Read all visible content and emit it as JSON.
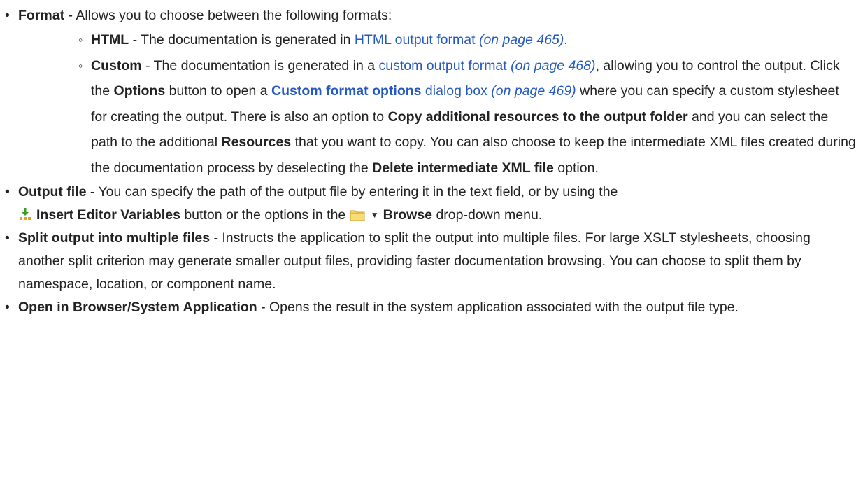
{
  "format": {
    "term": "Format",
    "desc": " - Allows you to choose between the following formats:",
    "html": {
      "term": "HTML",
      "t1": " - The documentation is generated in ",
      "link": "HTML output format",
      "ref": "(on page 465)",
      "t2": "."
    },
    "custom": {
      "term": "Custom",
      "t1": " - The documentation is generated in a ",
      "link": "custom output format",
      "ref1": "(on page 468)",
      "t2": ", allowing you to control the output. Click the ",
      "options": "Options",
      "t3": " button to open a ",
      "dialog_bold": "Custom format options",
      "dialog_rest": " dialog box",
      "ref2": "(on page 469)",
      "t4": " where you can specify a custom stylesheet for creating the output. There is also an option to ",
      "copy": "Copy additional resources to the output folder",
      "t5": " and you can select the path to the additional ",
      "resources": "Resources",
      "t6": " that you want to copy. You can also choose to keep the intermediate XML files created during the documentation process by deselecting the ",
      "delete": "Delete intermediate XML file",
      "t7": " option."
    }
  },
  "output_file": {
    "term": "Output file",
    "t1": " - You can specify the path of the output file by entering it in the text field, or by using the",
    "insert": "Insert Editor Variables",
    "t2": " button or the options in the ",
    "browse": "Browse",
    "t3": " drop-down menu."
  },
  "split": {
    "term": "Split output into multiple files",
    "desc": " - Instructs the application to split the output into multiple files. For large XSLT stylesheets, choosing another split criterion may generate smaller output files, providing faster documentation browsing. You can choose to split them by namespace, location, or component name."
  },
  "open": {
    "term": "Open in Browser/System Application",
    "desc": " - Opens the result in the system application associated with the output file type."
  },
  "icons": {
    "insert": "insert-editor-variables-icon",
    "folder": "folder-icon",
    "dropdown": "dropdown-caret-icon"
  },
  "colors": {
    "link": "#2459c0",
    "text": "#222222",
    "insert_icon_green": "#3a9a2a",
    "insert_icon_orange": "#e8a020",
    "folder_yellow": "#f4cf5a"
  }
}
